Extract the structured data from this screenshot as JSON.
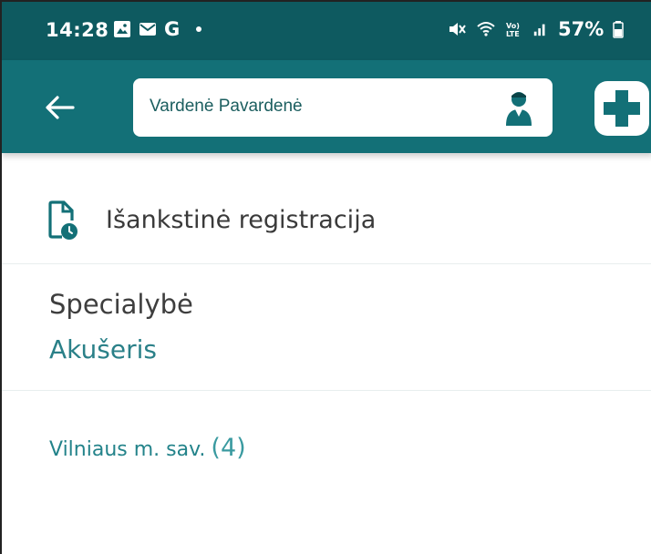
{
  "status_bar": {
    "time": "14:28",
    "left_icons": [
      "gallery-icon",
      "mail-icon",
      "google-icon",
      "dot-icon"
    ],
    "google_letter": "G",
    "right_icons": [
      "mute-icon",
      "wifi-icon",
      "volte-icon",
      "signal-icon",
      "battery-icon"
    ],
    "battery_percent": "57%",
    "volte_label": "Vo)\nLTE",
    "background_color": "#0e5a60"
  },
  "app_bar": {
    "user_name": "Vardenė Pavardenė",
    "background_color": "#137077",
    "back_icon": "arrow-left-icon",
    "profile_icon": "person-icon",
    "action_icon": "medical-cross-icon"
  },
  "section": {
    "title": "Išankstinė registracija",
    "icon": "document-clock-icon"
  },
  "specialty": {
    "label": "Specialybė",
    "value": "Akušeris"
  },
  "regions": [
    {
      "name": "Vilniaus m. sav.",
      "count": "(4)"
    }
  ],
  "colors": {
    "accent": "#2a8088",
    "text_dark": "#3a3a3a"
  }
}
